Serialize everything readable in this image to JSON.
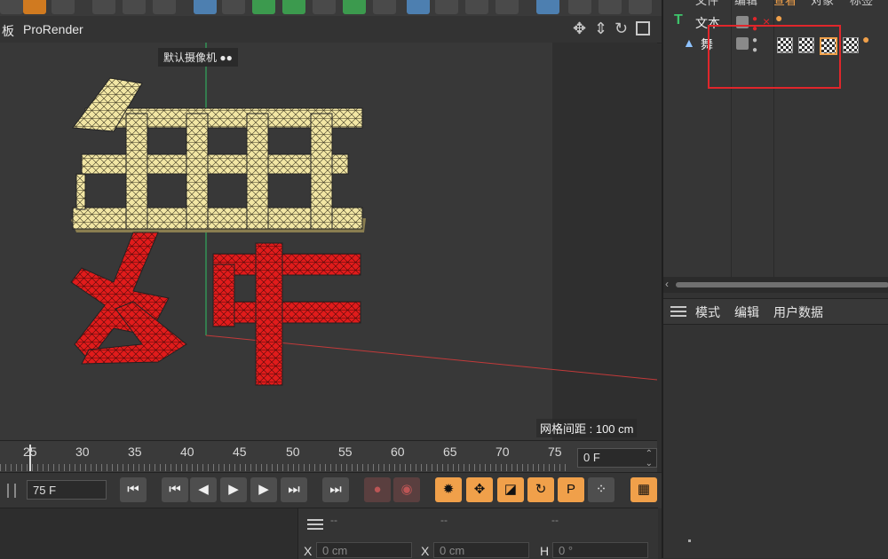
{
  "viewport_menu": {
    "left_cut": "板",
    "renderer": "ProRender"
  },
  "viewport": {
    "camera_label": "默认摄像机",
    "grid_spacing": "网格间距 : 100 cm",
    "glyph_top_color": "#f2e6a4",
    "glyph_bottom_color": "#e11b1b"
  },
  "timeline": {
    "ticks": [
      "25",
      "30",
      "35",
      "40",
      "45",
      "50",
      "55",
      "60",
      "65",
      "70",
      "75"
    ],
    "current_frame": "0 F"
  },
  "transport": {
    "end_frame": "75 F"
  },
  "coords": {
    "x_label": "X",
    "x_value": "0 cm",
    "x2_label": "X",
    "x2_value": "0 cm",
    "h_label": "H",
    "h_value": "0 °",
    "dashes": [
      "--",
      "--",
      "--"
    ]
  },
  "object_manager": {
    "menu": [
      "文件",
      "编辑",
      "查看",
      "对象",
      "标签"
    ],
    "objects": [
      {
        "name": "文本",
        "icon": "text-object-icon"
      },
      {
        "name": "舞",
        "icon": "extrude-object-icon"
      }
    ]
  },
  "attributes": {
    "tabs": [
      "模式",
      "编辑",
      "用户数据"
    ]
  },
  "colors": {
    "accent_orange": "#f0a04a",
    "highlight_red": "#e0262b",
    "tool_blue": "#4d7fb0"
  }
}
